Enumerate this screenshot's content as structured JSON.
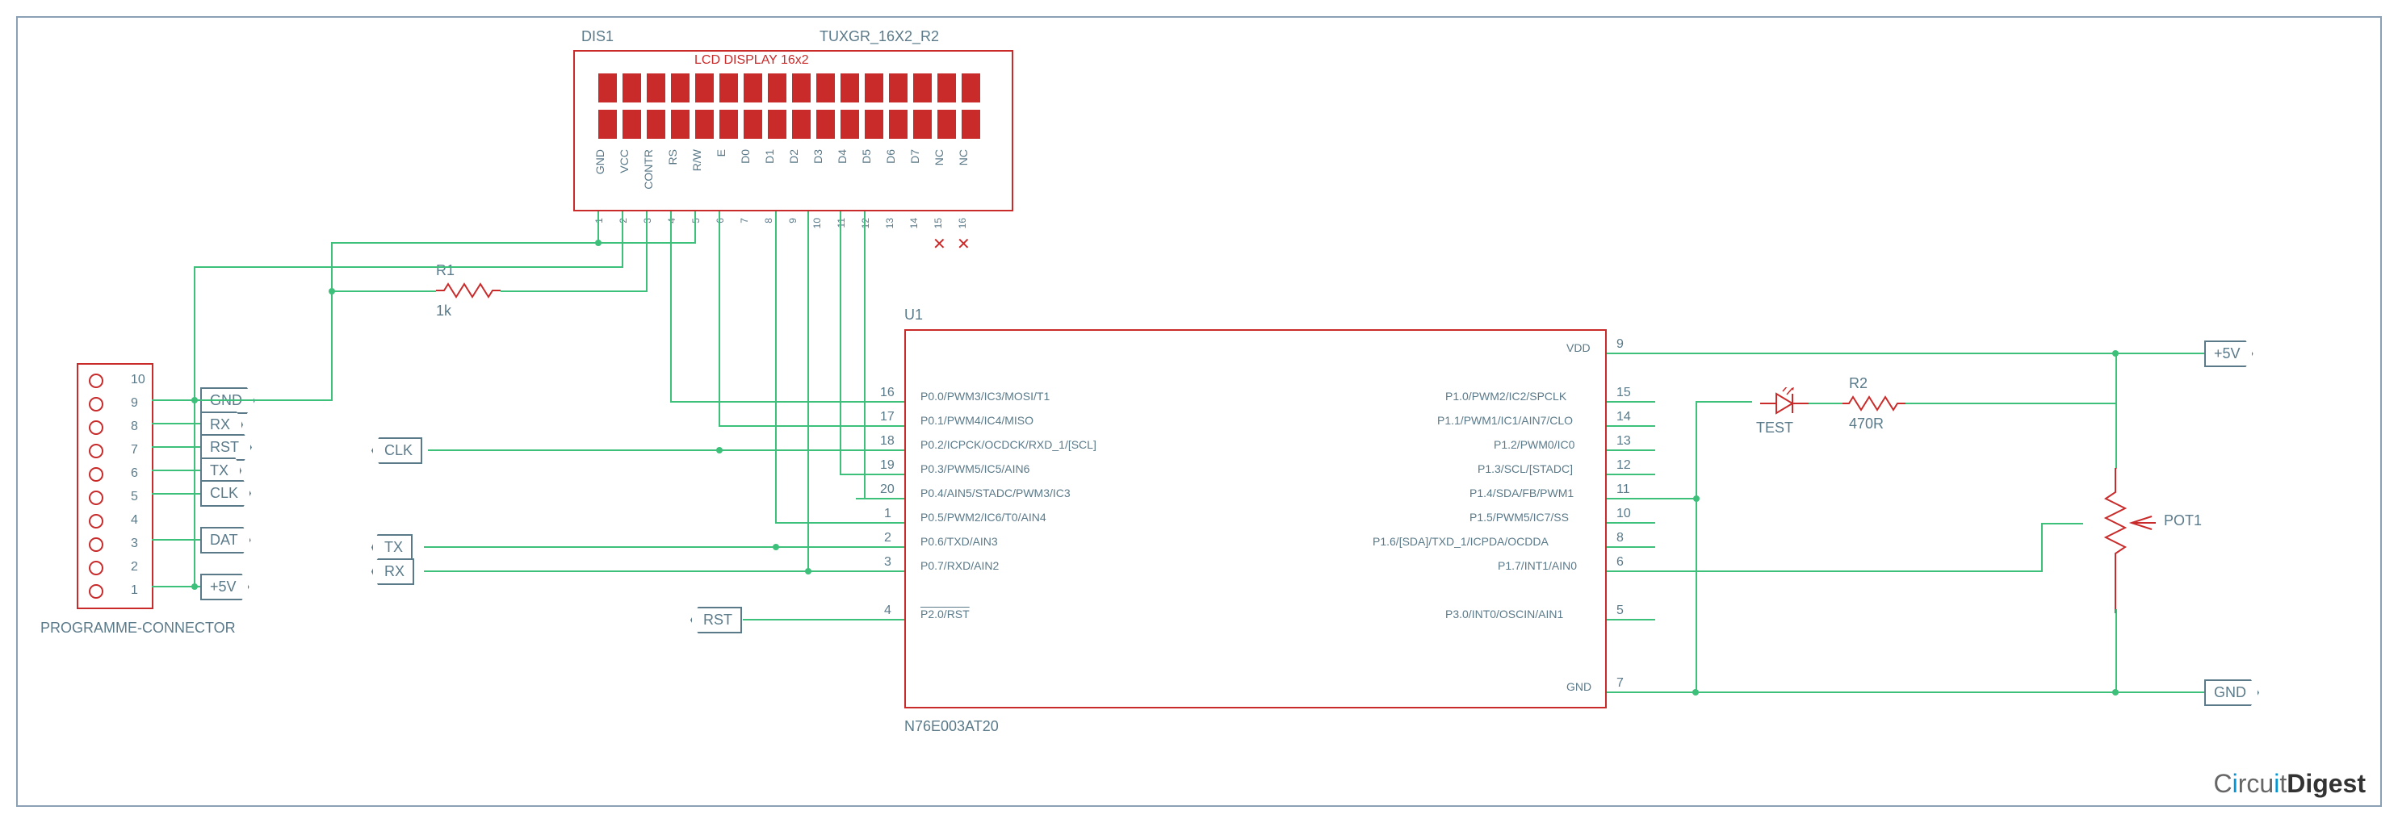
{
  "components": {
    "lcd": {
      "ref": "DIS1",
      "part": "TUXGR_16X2_R2",
      "title": "LCD DISPLAY 16x2",
      "pins": [
        "GND",
        "VCC",
        "CONTR",
        "RS",
        "R/W",
        "E",
        "D0",
        "D1",
        "D2",
        "D3",
        "D4",
        "D5",
        "D6",
        "D7",
        "NC",
        "NC"
      ],
      "pin_nums": [
        "1",
        "2",
        "3",
        "4",
        "5",
        "6",
        "7",
        "8",
        "9",
        "10",
        "11",
        "12",
        "13",
        "14",
        "15",
        "16"
      ]
    },
    "ic": {
      "ref": "U1",
      "part": "N76E003AT20",
      "left_pins": [
        {
          "num": "16",
          "name": "P0.0/PWM3/IC3/MOSI/T1"
        },
        {
          "num": "17",
          "name": "P0.1/PWM4/IC4/MISO"
        },
        {
          "num": "18",
          "name": "P0.2/ICPCK/OCDCK/RXD_1/[SCL]"
        },
        {
          "num": "19",
          "name": "P0.3/PWM5/IC5/AIN6"
        },
        {
          "num": "20",
          "name": "P0.4/AIN5/STADC/PWM3/IC3"
        },
        {
          "num": "1",
          "name": "P0.5/PWM2/IC6/T0/AIN4"
        },
        {
          "num": "2",
          "name": "P0.6/TXD/AIN3"
        },
        {
          "num": "3",
          "name": "P0.7/RXD/AIN2"
        },
        {
          "num": "4",
          "name": "P2.0/RST"
        }
      ],
      "right_pins": [
        {
          "num": "9",
          "name": "VDD"
        },
        {
          "num": "15",
          "name": "P1.0/PWM2/IC2/SPCLK"
        },
        {
          "num": "14",
          "name": "P1.1/PWM1/IC1/AIN7/CLO"
        },
        {
          "num": "13",
          "name": "P1.2/PWM0/IC0"
        },
        {
          "num": "12",
          "name": "P1.3/SCL/[STADC]"
        },
        {
          "num": "11",
          "name": "P1.4/SDA/FB/PWM1"
        },
        {
          "num": "10",
          "name": "P1.5/PWM5/IC7/SS"
        },
        {
          "num": "8",
          "name": "P1.6/[SDA]/TXD_1/ICPDA/OCDDA"
        },
        {
          "num": "6",
          "name": "P1.7/INT1/AIN0"
        },
        {
          "num": "5",
          "name": "P3.0/INT0/OSCIN/AIN1"
        },
        {
          "num": "7",
          "name": "GND"
        }
      ]
    },
    "connector": {
      "ref": "PROGRAMME-CONNECTOR",
      "pins": [
        "10",
        "9",
        "8",
        "7",
        "6",
        "5",
        "4",
        "3",
        "2",
        "1"
      ]
    },
    "r1": {
      "ref": "R1",
      "value": "1k"
    },
    "r2": {
      "ref": "R2",
      "value": "470R"
    },
    "led": {
      "ref": "TEST"
    },
    "pot": {
      "ref": "POT1"
    }
  },
  "nets": {
    "gnd": "GND",
    "rx": "RX",
    "rst": "RST",
    "tx": "TX",
    "clk": "CLK",
    "dat": "DAT",
    "p5v": "+5V"
  },
  "logo": {
    "part1": "C",
    "i": "i",
    "part2": "rcu",
    "i2": "i",
    "part3": "t",
    "bold": "Digest"
  }
}
